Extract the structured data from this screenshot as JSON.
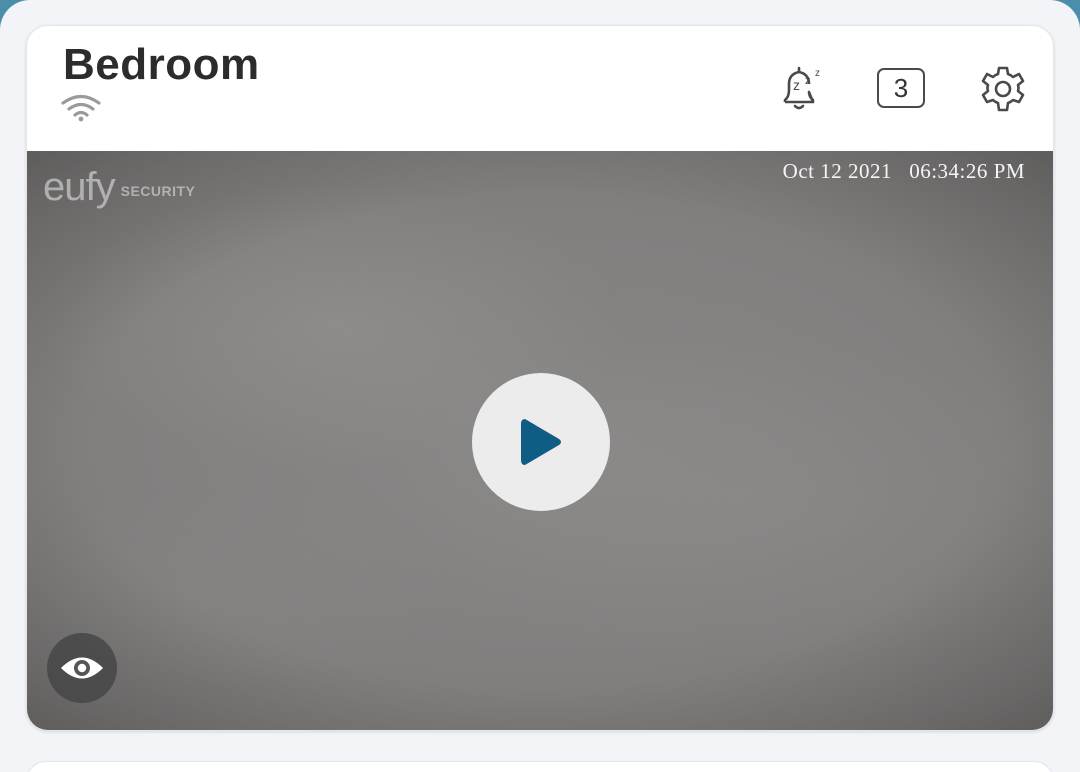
{
  "camera": {
    "name": "Bedroom",
    "connection_icon": "wifi-icon",
    "notification_count": "3"
  },
  "header_actions": [
    {
      "name": "snooze-notifications",
      "icon": "bell-snooze-icon"
    },
    {
      "name": "event-count",
      "icon": "count-badge"
    },
    {
      "name": "settings",
      "icon": "gear-icon"
    }
  ],
  "video": {
    "watermark_brand": "eufy",
    "watermark_sub": "SECURITY",
    "timestamp": "Oct 12 2021   06:34:26 PM",
    "play_icon": "play-icon",
    "view_icon": "eye-icon"
  },
  "colors": {
    "accent": "#4b8eac",
    "play_triangle": "#0f5d85",
    "page_bg": "#f2f4f7",
    "card_bg": "#ffffff"
  }
}
